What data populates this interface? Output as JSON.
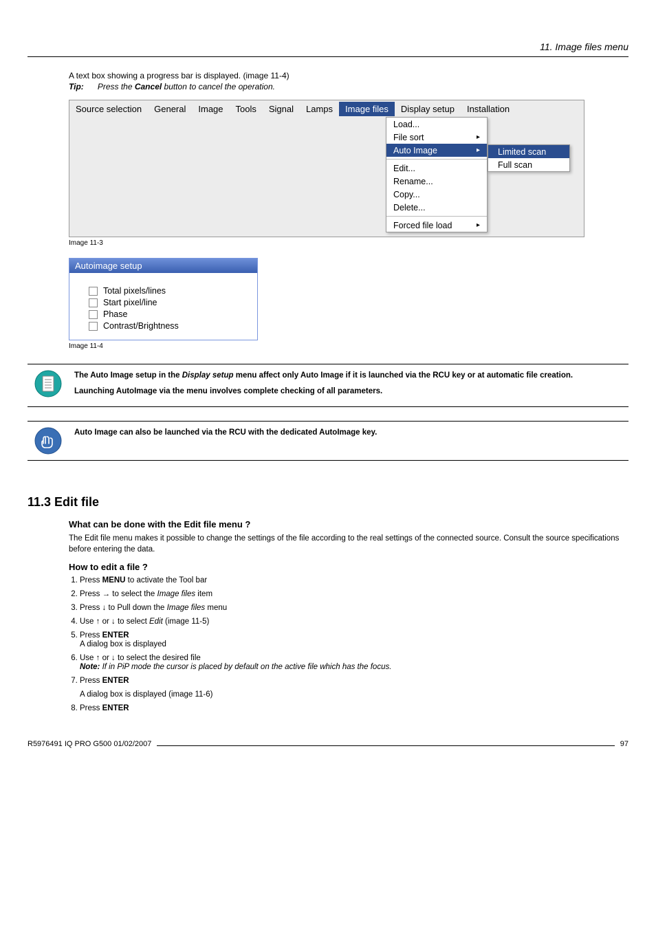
{
  "header": {
    "section_title": "11.  Image files menu"
  },
  "intro": {
    "line1": "A text box showing a progress bar is displayed.  (image 11-4)",
    "tip_label": "Tip:",
    "tip_text_prefix": "Press the ",
    "tip_bold": "Cancel",
    "tip_text_suffix": " button to cancel the operation."
  },
  "menubar": {
    "items": [
      "Source selection",
      "General",
      "Image",
      "Tools",
      "Signal",
      "Lamps",
      "Image files",
      "Display setup",
      "Installation"
    ],
    "selected_index": 6
  },
  "dropdown": {
    "items": [
      {
        "label": "Load...",
        "arrow": false
      },
      {
        "label": "File sort",
        "arrow": true
      },
      {
        "label": "Auto Image",
        "arrow": true,
        "selected": true
      },
      {
        "sep": true
      },
      {
        "label": "Edit...",
        "arrow": false
      },
      {
        "label": "Rename...",
        "arrow": false
      },
      {
        "label": "Copy...",
        "arrow": false
      },
      {
        "label": "Delete...",
        "arrow": false
      },
      {
        "sep": true
      },
      {
        "label": "Forced file load",
        "arrow": true
      }
    ]
  },
  "submenu": {
    "items": [
      {
        "label": "Limited scan",
        "selected": true
      },
      {
        "label": "Full scan"
      }
    ]
  },
  "caption1": "Image 11-3",
  "dialog": {
    "title": "Autoimage setup",
    "options": [
      "Total pixels/lines",
      "Start pixel/line",
      "Phase",
      "Contrast/Brightness"
    ]
  },
  "caption2": "Image 11-4",
  "callout1": {
    "p1_a": "The Auto Image setup in the ",
    "p1_b": "Display setup",
    "p1_c": " menu affect only Auto Image if it is launched via the RCU key or at automatic file creation.",
    "p2": "Launching AutoImage via the menu involves complete checking of all parameters."
  },
  "callout2": {
    "text": "Auto Image can also be launched via the RCU with the dedicated AutoImage key."
  },
  "section": {
    "num_title": "11.3  Edit file",
    "h1": "What can be done with the Edit file menu ?",
    "p1": "The Edit file menu makes it possible to change the settings of the file according to the real settings of the connected source.  Consult the source specifications before entering the data.",
    "h2": "How to edit a file ?",
    "steps": [
      {
        "t1": "Press ",
        "b": "MENU",
        "t2": " to activate the Tool bar"
      },
      {
        "t1": "Press → to select the ",
        "i": "Image files",
        "t2": " item"
      },
      {
        "t1": "Press ↓ to Pull down the ",
        "i": "Image files",
        "t2": " menu"
      },
      {
        "t1": "Use ↑ or ↓ to select ",
        "i": "Edit",
        "t2": " (image 11-5)"
      },
      {
        "t1": "Press ",
        "b": "ENTER",
        "sub": "A dialog box is displayed"
      },
      {
        "t1": "Use ↑ or ↓ to select the desired file",
        "note_label": "Note:",
        "note": "If in PiP mode the cursor is placed by default on the active file which has the focus."
      },
      {
        "t1": "Press ",
        "b": "ENTER",
        "sub_spaced": "A dialog box is displayed (image 11-6)"
      },
      {
        "t1": "Press ",
        "b": "ENTER"
      }
    ]
  },
  "footer": {
    "left": "R5976491  IQ PRO G500  01/02/2007",
    "right": "97"
  }
}
